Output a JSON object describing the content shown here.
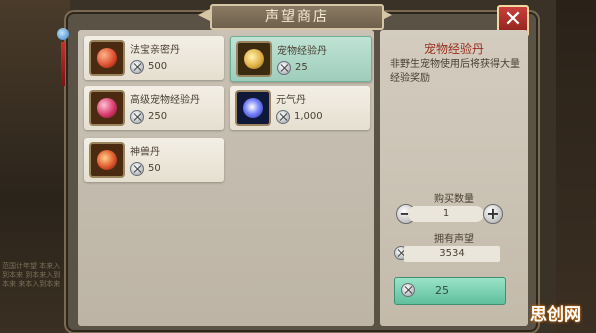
{
  "window": {
    "title": "声望商店",
    "close_label": "✕"
  },
  "background": {
    "left_text": "范国计年望 本来入到本来 到本来入到本来 来本入到本来"
  },
  "items": [
    {
      "name": "法宝亲密丹",
      "price": "500",
      "icon_color": "#d9482b",
      "icon": "red-orb-icon"
    },
    {
      "name": "宠物经验丹",
      "price": "25",
      "icon_color": "#e0b046",
      "icon": "gold-herb-icon",
      "selected": true
    },
    {
      "name": "高级宠物经验丹",
      "price": "250",
      "icon_color": "#d83a6c",
      "icon": "berry-cluster-icon"
    },
    {
      "name": "元气丹",
      "price": "1,000",
      "icon_color": "#7a86ff",
      "icon": "energy-orb-icon"
    },
    {
      "name": "神兽丹",
      "price": "50",
      "icon_color": "#e0562c",
      "icon": "beast-pill-icon"
    }
  ],
  "detail": {
    "title": "宠物经验丹",
    "description": "非野生宠物使用后将获得大量经验奖励",
    "quantity_label": "购买数量",
    "quantity": "1",
    "minus": "−",
    "plus": "+",
    "owned_label": "拥有声望",
    "owned_value": "3534",
    "buy_price": "25"
  },
  "watermark": "思创网",
  "colors": {
    "selected_card": "#9fcdbb",
    "buy_button": "#5fbf9d",
    "close_button": "#c9413a",
    "detail_title": "#9a2f1f"
  }
}
